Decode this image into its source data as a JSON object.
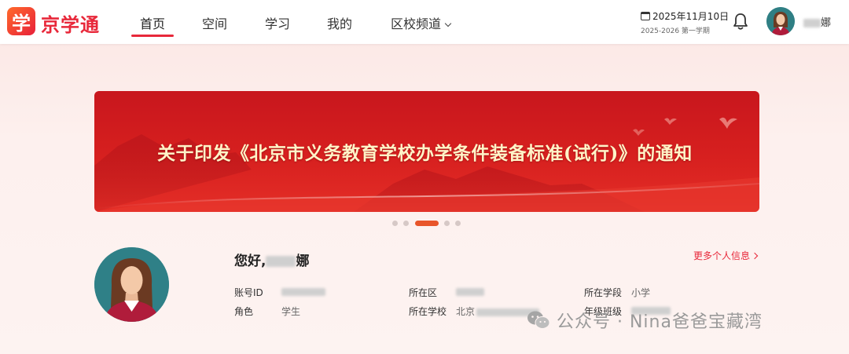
{
  "header": {
    "logo_glyph": "学",
    "logo_text": "京学通",
    "nav": [
      {
        "label": "首页",
        "active": true
      },
      {
        "label": "空间",
        "active": false
      },
      {
        "label": "学习",
        "active": false
      },
      {
        "label": "我的",
        "active": false
      },
      {
        "label": "区校频道",
        "active": false,
        "has_dropdown": true
      }
    ],
    "date": "2025年11月10日",
    "term": "2025-2026 第一学期",
    "notification_icon": "bell-icon",
    "user_name_suffix": "娜"
  },
  "banner": {
    "title": "关于印发《北京市义务教育学校办学条件装备标准(试行)》的通知",
    "slide_count": 5,
    "active_slide": 3
  },
  "profile": {
    "greeting_prefix": "您好,",
    "greeting_suffix": "娜",
    "more_link": "更多个人信息",
    "fields": {
      "account_id_label": "账号ID",
      "role_label": "角色",
      "role_value": "学生",
      "district_label": "所在区",
      "school_label": "所在学校",
      "school_value_prefix": "北京",
      "stage_label": "所在学段",
      "stage_value": "小学",
      "class_label": "年级班级"
    }
  },
  "watermark": {
    "text": "公众号 · Nina爸爸宝藏湾"
  },
  "colors": {
    "accent": "#e8283a",
    "banner_red": "#d7201f",
    "banner_text": "#fff4c8",
    "active_dot": "#e8552a"
  }
}
